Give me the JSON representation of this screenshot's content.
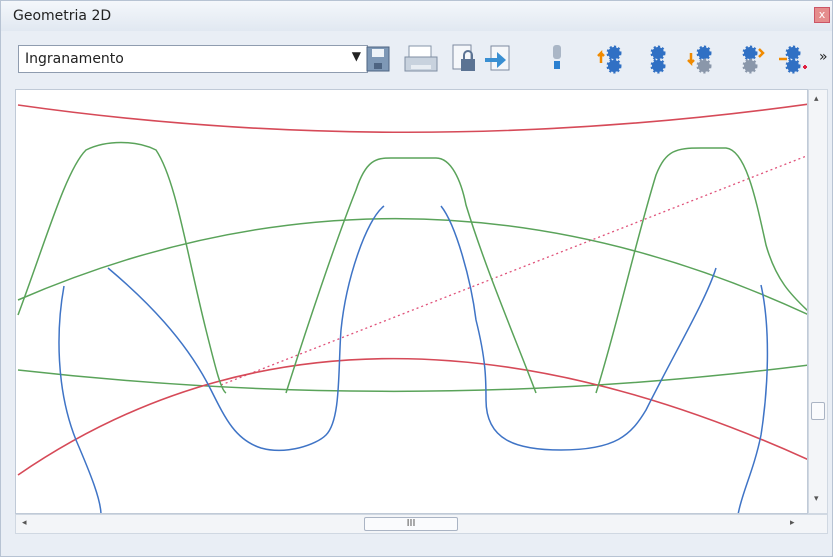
{
  "window": {
    "title": "Geometria 2D",
    "close_glyph": "x"
  },
  "toolbar": {
    "view_select": {
      "value": "Ingranamento"
    },
    "buttons": [
      {
        "icon": "save-icon"
      },
      {
        "icon": "print-icon"
      },
      {
        "icon": "export-lock-icon"
      },
      {
        "icon": "import-icon"
      },
      {
        "icon": "probe-icon"
      },
      {
        "icon": "gear-up-icon"
      },
      {
        "icon": "gear-set-icon"
      },
      {
        "icon": "gear-down-icon"
      },
      {
        "icon": "gear-grey-icon"
      },
      {
        "icon": "gear-add-icon"
      }
    ],
    "more_glyph": "»"
  },
  "scroll": {
    "h_thumb_glyph": "III",
    "left_arrow": "◂",
    "right_arrow": "▸",
    "up_arrow": "▴",
    "down_arrow": "▾"
  },
  "colors": {
    "red": "#d64a58",
    "green": "#5aa35a",
    "blue": "#3f74c6",
    "pink": "#e0527a"
  }
}
